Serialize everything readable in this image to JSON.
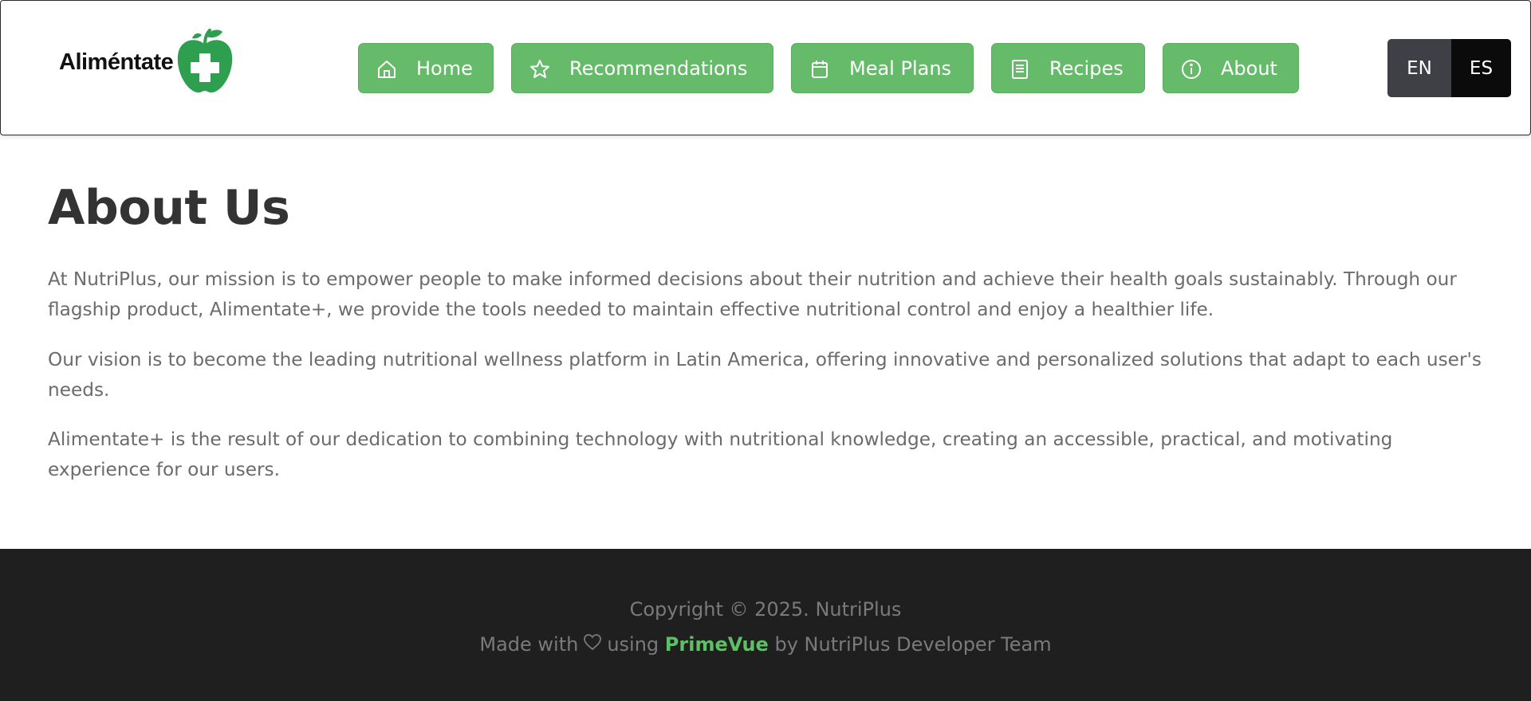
{
  "brand": {
    "logo_text": "Aliméntate",
    "accent": "#66bb6a",
    "icon": "apple-plus-logo"
  },
  "nav": [
    {
      "label": "Home",
      "icon": "home-icon"
    },
    {
      "label": "Recommendations",
      "icon": "star-icon"
    },
    {
      "label": "Meal Plans",
      "icon": "calendar-icon"
    },
    {
      "label": "Recipes",
      "icon": "book-icon"
    },
    {
      "label": "About",
      "icon": "info-icon"
    }
  ],
  "language": {
    "en": "EN",
    "es": "ES",
    "selected": "ES"
  },
  "main": {
    "title": "About Us",
    "paragraphs": [
      "At NutriPlus, our mission is to empower people to make informed decisions about their nutrition and achieve their health goals sustainably. Through our flagship product, Alimentate+, we provide the tools needed to maintain effective nutritional control and enjoy a healthier life.",
      "Our vision is to become the leading nutritional wellness platform in Latin America, offering innovative and personalized solutions that adapt to each user's needs.",
      "Alimentate+ is the result of our dedication to combining technology with nutritional knowledge, creating an accessible, practical, and motivating experience for our users."
    ]
  },
  "footer": {
    "copyright": "Copyright © 2025. NutriPlus",
    "made_with": "Made with",
    "using": "using",
    "framework": "PrimeVue",
    "by": "by NutriPlus Developer Team",
    "heart_icon": "heart-icon"
  }
}
